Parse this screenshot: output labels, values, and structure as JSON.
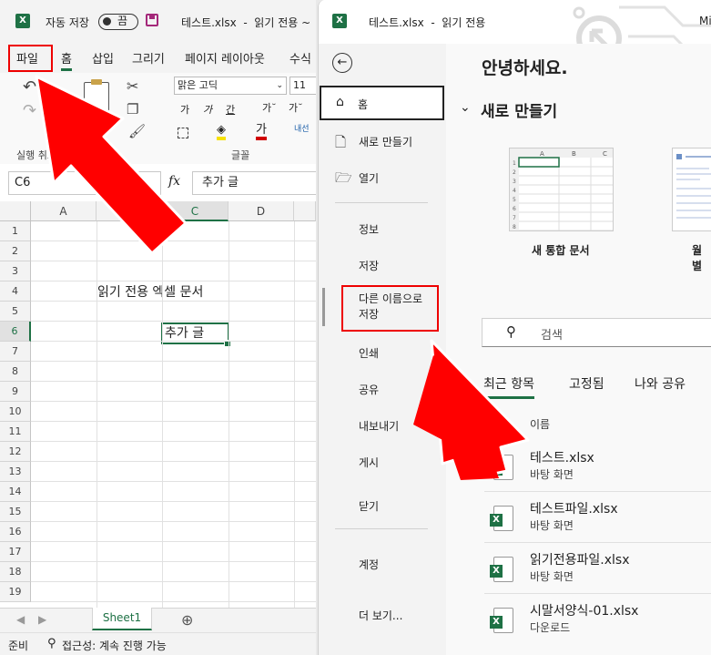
{
  "left": {
    "title_bar": {
      "autosave_label": "자동 저장",
      "toggle_state": "끔",
      "file_title": "테스트.xlsx  -  읽기 전용 ~"
    },
    "menu": [
      "파일",
      "홈",
      "삽입",
      "그리기",
      "페이지 레이아웃",
      "수식"
    ],
    "ribbon": {
      "font_name": "맑은 고딕",
      "font_size": "11",
      "font_btns": [
        "가",
        "가",
        "간",
        "가˘",
        "가˘"
      ],
      "wrap_label": "내선",
      "group_undo": "실행 취소",
      "group_font": "글꼴",
      "icons": [
        "undo-icon",
        "redo-icon",
        "paste-icon",
        "cut-icon",
        "copy-icon",
        "format-painter-icon",
        "border-icon",
        "fill-color-icon",
        "font-color-icon"
      ],
      "colors": {
        "fill": "#f6e100",
        "font": "#d00000"
      }
    },
    "namebox": "C6",
    "fx_label": "fx",
    "formula_value": "추가 글",
    "columns": [
      "A",
      "B",
      "C",
      "D"
    ],
    "rows": [
      "1",
      "2",
      "3",
      "4",
      "5",
      "6",
      "7",
      "8",
      "9",
      "10",
      "11",
      "12",
      "13",
      "14",
      "15",
      "16",
      "17",
      "18",
      "19"
    ],
    "cells": {
      "B4": "읽기 전용 엑셀 문서",
      "C6": "추가 글"
    },
    "sheet_tab": "Sheet1",
    "add_sheet": "⊕",
    "status_ready": "준비",
    "status_accessibility": "접근성: 계속 진행 가능"
  },
  "right": {
    "title": "테스트.xlsx  -  읽기 전용",
    "sidebar": {
      "back_icon": "back-arrow-icon",
      "items": [
        {
          "label": "홈",
          "icon": "home-icon"
        },
        {
          "label": "새로 만들기",
          "icon": "new-file-icon"
        },
        {
          "label": "열기",
          "icon": "folder-icon"
        },
        {
          "label": "정보"
        },
        {
          "label": "저장"
        },
        {
          "label": "다른 이름으로\n저장"
        },
        {
          "label": "인쇄"
        },
        {
          "label": "공유"
        },
        {
          "label": "내보내기"
        },
        {
          "label": "게시"
        },
        {
          "label": "닫기"
        },
        {
          "label": "계정"
        },
        {
          "label": "더 보기..."
        }
      ]
    },
    "main": {
      "greeting": "안녕하세요.",
      "new_section": "새로 만들기",
      "templates": [
        {
          "label": "새 통합 문서"
        },
        {
          "label": "월별"
        }
      ],
      "search_placeholder": "검색",
      "tabs": [
        "최근 항목",
        "고정됨",
        "나와 공유"
      ],
      "name_header": "이름",
      "files": [
        {
          "name": "테스트.xlsx",
          "location": "바탕 화면"
        },
        {
          "name": "테스트파일.xlsx",
          "location": "바탕 화면"
        },
        {
          "name": "읽기전용파일.xlsx",
          "location": "바탕 화면"
        },
        {
          "name": "시말서양식-01.xlsx",
          "location": "다운로드"
        }
      ]
    }
  },
  "annotation_colors": {
    "arrow": "#ff0000",
    "highlight": "#e00000"
  }
}
